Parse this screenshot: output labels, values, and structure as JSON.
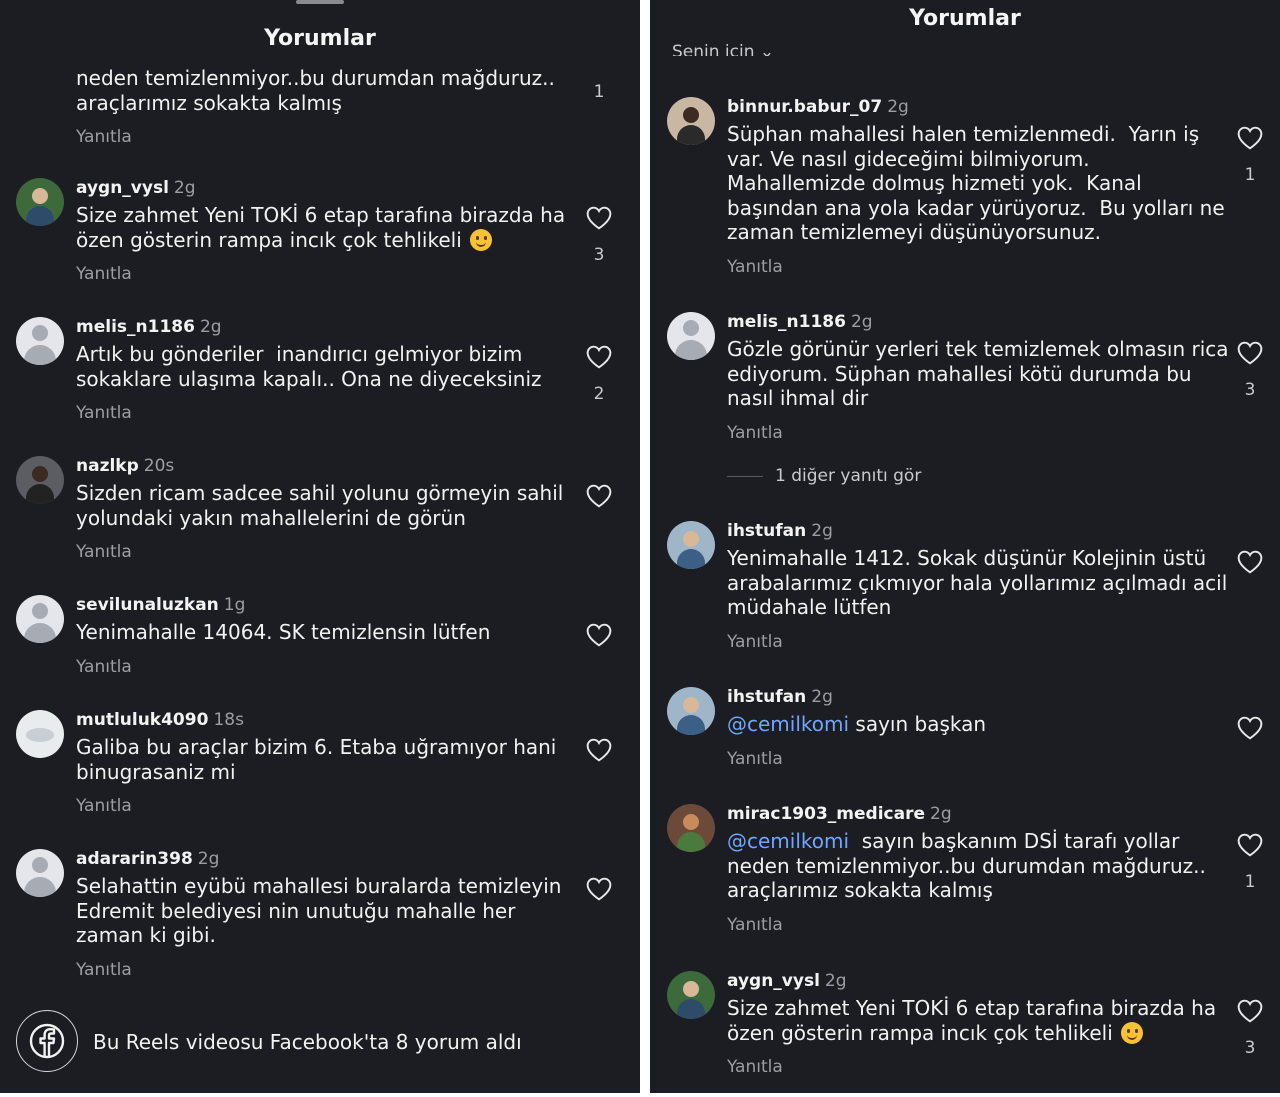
{
  "left": {
    "title": "Yorumlar",
    "partial_comment": {
      "text": "neden temizlenmiyor..bu durumdan mağduruz..\naraçlarımız sokakta kalmış",
      "reply": "Yanıtla",
      "likes": "1"
    },
    "comments": [
      {
        "user": "aygn_vysl",
        "time": "2g",
        "text": "Size zahmet Yeni TOKİ 6 etap tarafına birazda ha\nözen gösterin rampa incık çok tehlikeli",
        "emoji": "slightly-smiling-face",
        "reply": "Yanıtla",
        "likes": "3"
      },
      {
        "user": "melis_n1186",
        "time": "2g",
        "text": "Artık bu gönderiler  inandırıcı gelmiyor bizim\nsokaklare ulaşıma kapalı.. Ona ne diyeceksiniz",
        "reply": "Yanıtla",
        "likes": "2"
      },
      {
        "user": "nazlkp",
        "time": "20s",
        "text": "Sizden ricam sadcee sahil yolunu görmeyin sahil\nyolundaki yakın mahallelerini de görün",
        "reply": "Yanıtla",
        "likes": ""
      },
      {
        "user": "sevilunaluzkan",
        "time": "1g",
        "text": "Yenimahalle 14064. SK temizlensin lütfen",
        "reply": "Yanıtla",
        "likes": ""
      },
      {
        "user": "mutluluk4090",
        "time": "18s",
        "text": "Galiba bu araçlar bizim 6. Etaba uğramıyor hani\nbinugrasaniz mi",
        "reply": "Yanıtla",
        "likes": ""
      },
      {
        "user": "adararin398",
        "time": "2g",
        "text": "Selahattin eyübü mahallesi buralarda temizleyin\nEdremit belediyesi nin unutuğu mahalle her\nzaman ki gibi.",
        "reply": "Yanıtla",
        "likes": ""
      }
    ],
    "facebook_notice": "Bu Reels videosu Facebook'ta 8 yorum aldı"
  },
  "right": {
    "title": "Yorumlar",
    "sort_label": "Senin için",
    "comments": [
      {
        "user": "binnur.babur_07",
        "time": "2g",
        "text": "Süphan mahallesi halen temizlenmedi.  Yarın iş\nvar. Ve nasıl gideceğimi bilmiyorum.\nMahallemizde dolmuş hizmeti yok.  Kanal\nbaşından ana yola kadar yürüyoruz.  Bu yolları ne\nzaman temizlemeyi düşünüyorsunuz.",
        "reply": "Yanıtla",
        "likes": "1"
      },
      {
        "user": "melis_n1186",
        "time": "2g",
        "text": "Gözle görünür yerleri tek temizlemek olmasın rica\nediyorum. Süphan mahallesi kötü durumda bu\nnasıl ihmal dir",
        "reply": "Yanıtla",
        "likes": "3"
      },
      {
        "user": "ihstufan",
        "time": "2g",
        "text": "Yenimahalle 1412. Sokak düşünür Kolejinin üstü\narabalarımız çıkmıyor hala yollarımız açılmadı acil\nmüdahale lütfen",
        "reply": "Yanıtla",
        "likes": ""
      },
      {
        "user": "ihstufan",
        "time": "2g",
        "mention": "@cemilkomi",
        "text": " sayın başkan",
        "reply": "Yanıtla",
        "likes": ""
      },
      {
        "user": "mirac1903_medicare",
        "time": "2g",
        "mention": "@cemilkomi",
        "text": "  sayın başkanım DSİ tarafı yollar\nneden temizlenmiyor..bu durumdan mağduruz..\naraçlarımız sokakta kalmış",
        "reply": "Yanıtla",
        "likes": "1"
      },
      {
        "user": "aygn_vysl",
        "time": "2g",
        "text": "Size zahmet Yeni TOKİ 6 etap tarafına birazda ha\nözen gösterin rampa incık çok tehlikeli",
        "emoji": "slightly-smiling-face",
        "reply": "Yanıtla",
        "likes": "3"
      }
    ],
    "more_replies": "1 diğer yanıtı gör"
  }
}
